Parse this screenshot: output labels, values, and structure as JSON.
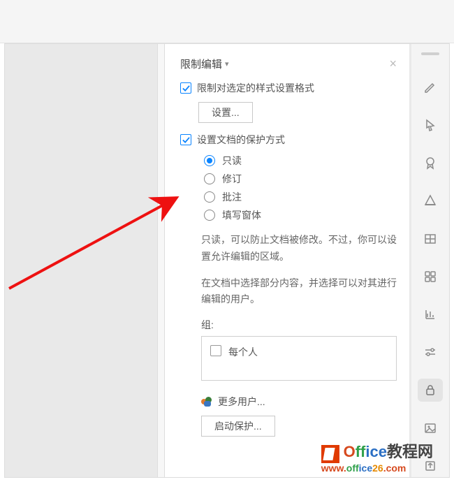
{
  "panel": {
    "title": "限制编辑",
    "close": "×",
    "limit_format_checkbox_checked": true,
    "limit_format_label": "限制对选定的样式设置格式",
    "settings_button": "设置...",
    "protect_checkbox_checked": true,
    "protect_label": "设置文档的保护方式",
    "options": {
      "readonly": "只读",
      "revision": "修订",
      "comment": "批注",
      "form": "填写窗体",
      "selected": "readonly"
    },
    "desc1": "只读，可以防止文档被修改。不过，你可以设置允许编辑的区域。",
    "desc2": "在文档中选择部分内容，并选择可以对其进行编辑的用户。",
    "group_label": "组:",
    "group_everyone": "每个人",
    "more_users": "更多用户...",
    "start_button": "启动保护..."
  },
  "watermark": {
    "line1": "Office教程网",
    "line2": "www.office26.com"
  },
  "rail": {
    "icons": [
      "pencil",
      "cursor",
      "ribbon",
      "triangle",
      "grid",
      "apps",
      "chart",
      "sliders",
      "lock",
      "image",
      "share"
    ]
  }
}
